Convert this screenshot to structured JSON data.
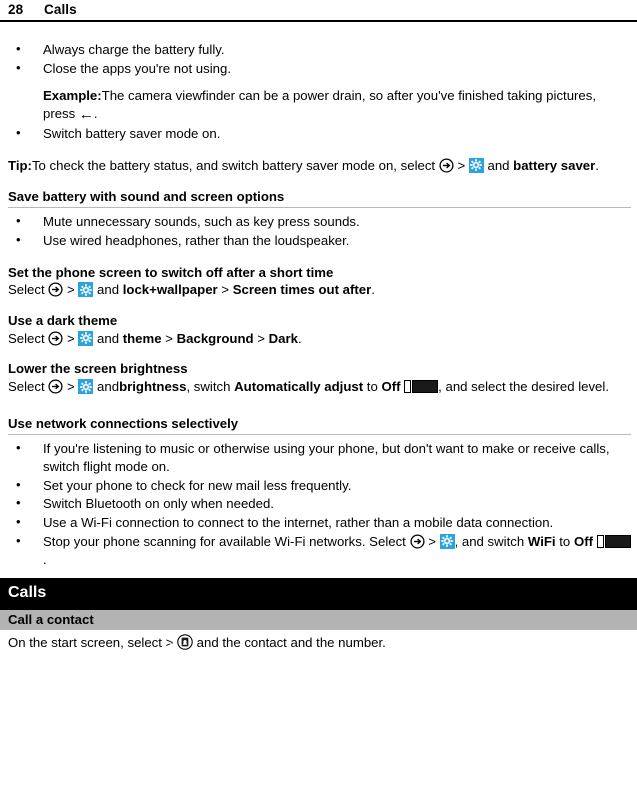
{
  "header": {
    "page_number": "28",
    "chapter_title": "Calls"
  },
  "icons": {
    "arrow_circle": "arrow-right-circle-icon",
    "settings": "settings-gear-icon",
    "back_arrow": "back-arrow-icon",
    "toggle_off": "toggle-switch-off-icon",
    "phone": "phone-icon",
    "contacts": "contacts-icon"
  },
  "colors": {
    "accent_blue": "#2ba3dc",
    "band_gray": "#b3b3b3",
    "banner_black": "#000000",
    "rule_gray": "#b9b9b9"
  },
  "battery_tips": {
    "bullet1": "Always charge the battery fully.",
    "bullet2": "Close the apps you're not using.",
    "example_label": "Example:",
    "example_text_a": "The camera viewfinder can be a power drain, so after you've finished taking pictures, press ",
    "example_text_b": ".",
    "bullet3": "Switch battery saver mode on.",
    "tip_label": "Tip:",
    "tip_text_a": "To check the battery status, and switch battery saver mode on, select ",
    "tip_gt": ">",
    "tip_text_b": "and ",
    "tip_bold": "battery saver",
    "tip_text_c": "."
  },
  "sound_screen": {
    "heading": "Save battery with sound and screen options",
    "bullet1": "Mute unnecessary sounds, such as key press sounds.",
    "bullet2": "Use wired headphones, rather than the loudspeaker."
  },
  "screen_timeout": {
    "heading": "Set the phone screen to switch off after a short time",
    "select": "Select",
    "gt1": ">",
    "and": "and",
    "item1": "lock+wallpaper",
    "gt2": ">",
    "item2": "Screen times out after",
    "period": "."
  },
  "dark_theme": {
    "heading": "Use a dark theme",
    "select": "Select",
    "gt1": ">",
    "and": "and",
    "item1": "theme",
    "gt2": ">",
    "item2": "Background",
    "gt3": ">",
    "item3": "Dark",
    "period": "."
  },
  "brightness": {
    "heading": "Lower the screen brightness",
    "select": "Select",
    "gt1": ">",
    "and": "and",
    "item1": "brightness",
    "comma_switch": ", switch",
    "item2": "Automatically adjust",
    "to": "to",
    "item3": "Off",
    "tail": ", and select the desired level."
  },
  "network": {
    "heading": "Use network connections selectively",
    "bullet1": "If you're listening to music or otherwise using your phone, but don't want to make or receive calls, switch flight mode on.",
    "bullet2": "Set your phone to check for new mail less frequently.",
    "bullet3": "Switch Bluetooth on only when needed.",
    "bullet4": "Use a Wi-Fi connection to connect to the internet, rather than a mobile data connection.",
    "bullet5_a": "Stop your phone scanning for available Wi-Fi networks. Select ",
    "bullet5_gt": ">",
    "bullet5_b": ", and switch",
    "bullet5_bold1": "WiFi",
    "bullet5_to": "to",
    "bullet5_bold2": "Off",
    "bullet5_end": "."
  },
  "calls_chapter": {
    "banner": "Calls",
    "section_band": "Call a contact",
    "line_a": "On the start screen, select",
    "gt": ">",
    "line_b": "and the contact and the number."
  }
}
